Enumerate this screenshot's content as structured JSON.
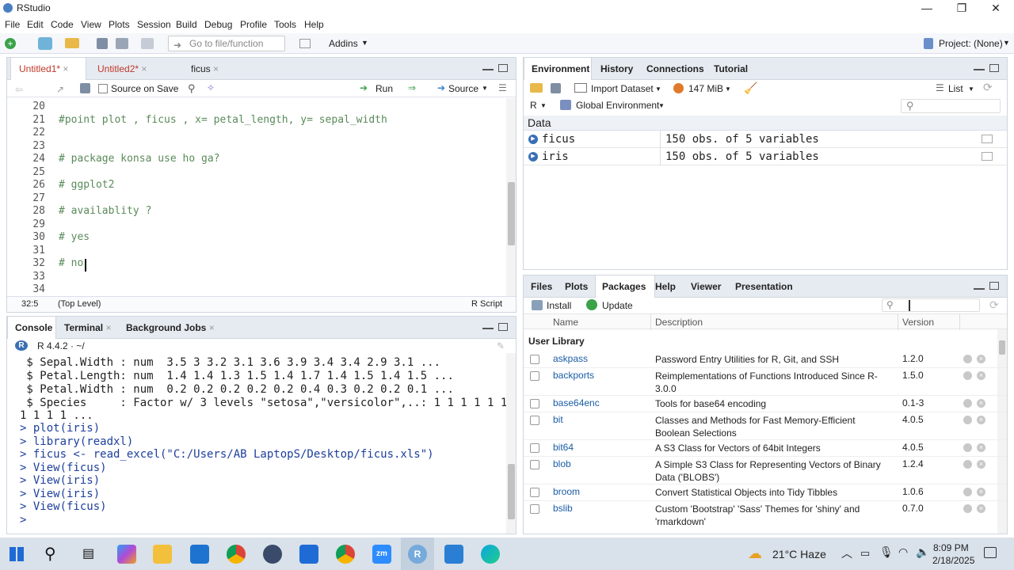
{
  "window": {
    "title": "RStudio",
    "min": "—",
    "max": "❐",
    "close": "✕"
  },
  "menu": [
    "File",
    "Edit",
    "Code",
    "View",
    "Plots",
    "Session",
    "Build",
    "Debug",
    "Profile",
    "Tools",
    "Help"
  ],
  "toolbar": {
    "goto_placeholder": "Go to file/function",
    "addins": "Addins",
    "project": "Project: (None)"
  },
  "editor": {
    "tabs": [
      "Untitled1*",
      "Untitled2*",
      "ficus"
    ],
    "source_on_save": "Source on Save",
    "run": "Run",
    "source": "Source",
    "lines": [
      {
        "n": "20",
        "t": ""
      },
      {
        "n": "21",
        "t": "#point plot , ficus , x= petal_length, y= sepal_width"
      },
      {
        "n": "22",
        "t": ""
      },
      {
        "n": "23",
        "t": ""
      },
      {
        "n": "24",
        "t": "# package konsa use ho ga?"
      },
      {
        "n": "25",
        "t": ""
      },
      {
        "n": "26",
        "t": "# ggplot2"
      },
      {
        "n": "27",
        "t": ""
      },
      {
        "n": "28",
        "t": "# availablity ?"
      },
      {
        "n": "29",
        "t": ""
      },
      {
        "n": "30",
        "t": "# yes"
      },
      {
        "n": "31",
        "t": ""
      },
      {
        "n": "32",
        "t": "# no"
      },
      {
        "n": "33",
        "t": ""
      },
      {
        "n": "34",
        "t": ""
      }
    ],
    "status": {
      "pos": "32:5",
      "scope": "(Top Level)",
      "type": "R Script"
    }
  },
  "console": {
    "tabs": [
      "Console",
      "Terminal",
      "Background Jobs"
    ],
    "version": "R 4.4.2 · ~/",
    "lines": [
      {
        "t": " $ Sepal.Width : num  3.5 3 3.2 3.1 3.6 3.9 3.4 3.4 2.9 3.1 ...",
        "in": false
      },
      {
        "t": " $ Petal.Length: num  1.4 1.4 1.3 1.5 1.4 1.7 1.4 1.5 1.4 1.5 ...",
        "in": false
      },
      {
        "t": " $ Petal.Width : num  0.2 0.2 0.2 0.2 0.2 0.4 0.3 0.2 0.2 0.1 ...",
        "in": false
      },
      {
        "t": " $ Species     : Factor w/ 3 levels \"setosa\",\"versicolor\",..: 1 1 1 1 1 1",
        "in": false
      },
      {
        "t": "1 1 1 1 ...",
        "in": false
      },
      {
        "t": "> plot(iris)",
        "in": true
      },
      {
        "t": "> library(readxl)",
        "in": true
      },
      {
        "t": "> ficus <- read_excel(\"C:/Users/AB LaptopS/Desktop/ficus.xls\")",
        "in": true
      },
      {
        "t": "> View(ficus)",
        "in": true
      },
      {
        "t": "> View(iris)",
        "in": true
      },
      {
        "t": "> View(iris)",
        "in": true
      },
      {
        "t": "> View(ficus)",
        "in": true
      },
      {
        "t": "> ",
        "in": true
      }
    ]
  },
  "env": {
    "tabs": [
      "Environment",
      "History",
      "Connections",
      "Tutorial"
    ],
    "import": "Import Dataset",
    "mem": "147 MiB",
    "list": "List",
    "lang": "R",
    "scope": "Global Environment",
    "section": "Data",
    "rows": [
      {
        "name": "ficus",
        "desc": "150 obs. of 5 variables"
      },
      {
        "name": "iris",
        "desc": "150 obs. of 5 variables"
      }
    ]
  },
  "files": {
    "tabs": [
      "Files",
      "Plots",
      "Packages",
      "Help",
      "Viewer",
      "Presentation"
    ],
    "install": "Install",
    "update": "Update",
    "headers": {
      "name": "Name",
      "desc": "Description",
      "ver": "Version"
    },
    "section": "User Library",
    "packages": [
      {
        "name": "askpass",
        "desc": "Password Entry Utilities for R, Git, and SSH",
        "ver": "1.2.0"
      },
      {
        "name": "backports",
        "desc": "Reimplementations of Functions Introduced Since R-3.0.0",
        "ver": "1.5.0"
      },
      {
        "name": "base64enc",
        "desc": "Tools for base64 encoding",
        "ver": "0.1-3"
      },
      {
        "name": "bit",
        "desc": "Classes and Methods for Fast Memory-Efficient Boolean Selections",
        "ver": "4.0.5"
      },
      {
        "name": "bit64",
        "desc": "A S3 Class for Vectors of 64bit Integers",
        "ver": "4.0.5"
      },
      {
        "name": "blob",
        "desc": "A Simple S3 Class for Representing Vectors of Binary Data ('BLOBS')",
        "ver": "1.2.4"
      },
      {
        "name": "broom",
        "desc": "Convert Statistical Objects into Tidy Tibbles",
        "ver": "1.0.6"
      },
      {
        "name": "bslib",
        "desc": "Custom 'Bootstrap' 'Sass' Themes for 'shiny' and 'rmarkdown'",
        "ver": "0.7.0"
      }
    ]
  },
  "taskbar": {
    "weather": "21°C  Haze",
    "time": "8:09 PM",
    "date": "2/18/2025"
  }
}
